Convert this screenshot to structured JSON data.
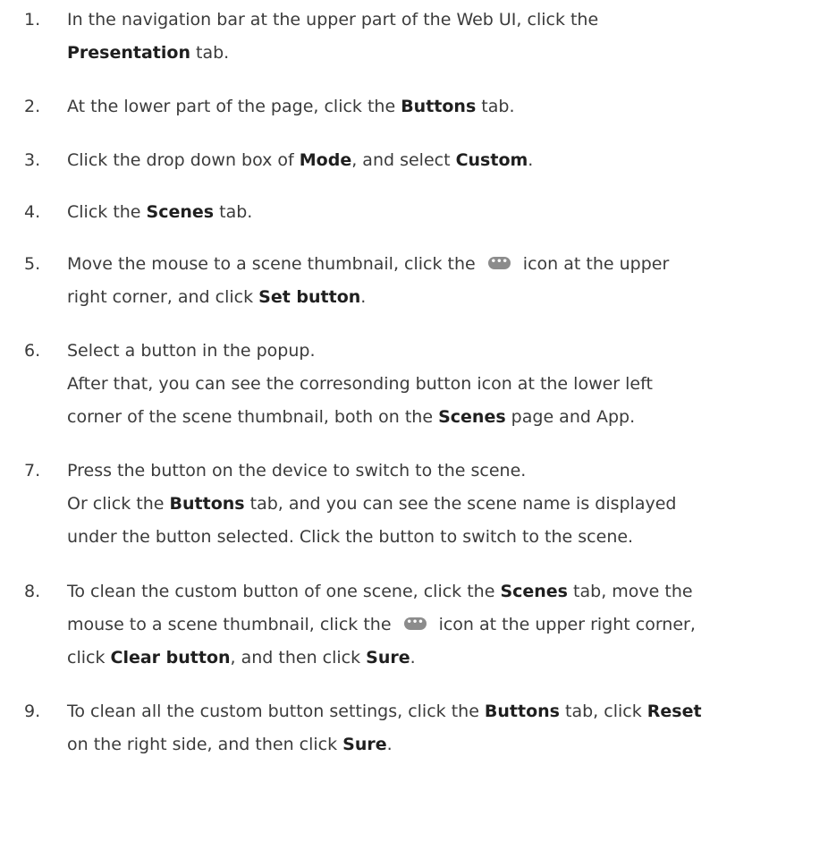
{
  "steps": [
    {
      "number": "1.",
      "lines": [
        [
          "In the navigation bar at the upper part of the Web UI, click the"
        ],
        [
          {
            "b": "Presentation"
          },
          " tab."
        ]
      ]
    },
    {
      "number": "2.",
      "lines": [
        [
          "At the lower part of the page, click the ",
          {
            "b": "Buttons"
          },
          " tab."
        ]
      ]
    },
    {
      "number": "3.",
      "lines": [
        [
          "Click the drop down box of ",
          {
            "b": "Mode"
          },
          ", and select ",
          {
            "b": "Custom"
          },
          "."
        ]
      ]
    },
    {
      "number": "4.",
      "lines": [
        [
          "Click the ",
          {
            "b": "Scenes"
          },
          " tab."
        ]
      ]
    },
    {
      "number": "5.",
      "lines": [
        [
          "Move the mouse to a scene thumbnail, click the ",
          {
            "icon": "more-icon"
          },
          " icon at the upper"
        ],
        [
          "right corner, and click ",
          {
            "b": "Set button"
          },
          "."
        ]
      ]
    },
    {
      "number": "6.",
      "lines": [
        [
          "Select a button in the popup."
        ],
        [
          "After that, you can see the corresonding button icon at the lower left"
        ],
        [
          "corner of the scene thumbnail, both on the ",
          {
            "b": "Scenes"
          },
          " page and App."
        ]
      ]
    },
    {
      "number": "7.",
      "lines": [
        [
          "Press the button on the device to switch to the scene."
        ],
        [
          "Or click the ",
          {
            "b": "Buttons"
          },
          " tab, and you can see the scene name is displayed"
        ],
        [
          "under the button selected. Click the button to switch to the scene."
        ]
      ]
    },
    {
      "number": "8.",
      "lines": [
        [
          "To clean the custom button of one scene, click the ",
          {
            "b": "Scenes"
          },
          " tab, move the"
        ],
        [
          "mouse to a scene thumbnail, click the ",
          {
            "icon": "more-icon"
          },
          " icon at the upper right corner,"
        ],
        [
          "click ",
          {
            "b": "Clear button"
          },
          ", and then click ",
          {
            "b": "Sure"
          },
          "."
        ]
      ]
    },
    {
      "number": "9.",
      "lines": [
        [
          "To clean all the custom button settings, click the ",
          {
            "b": "Buttons"
          },
          " tab, click ",
          {
            "b": "Reset"
          }
        ],
        [
          "on the right side, and then click ",
          {
            "b": "Sure"
          },
          "."
        ]
      ]
    }
  ]
}
